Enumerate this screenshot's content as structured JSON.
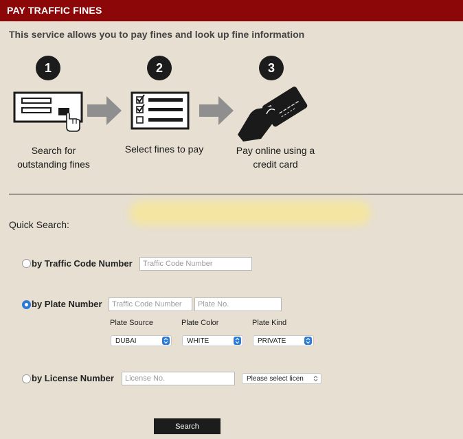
{
  "header": {
    "title": "PAY TRAFFIC FINES"
  },
  "intro": "This service allows you to pay fines and look up fine information",
  "steps": [
    {
      "number": "1",
      "line1": "Search for",
      "line2": "outstanding fines",
      "icon": "search-form-icon"
    },
    {
      "number": "2",
      "line1": "Select fines to pay",
      "line2": "",
      "icon": "checklist-icon"
    },
    {
      "number": "3",
      "line1": "Pay online using a",
      "line2": "credit card",
      "icon": "credit-card-hand-icon"
    }
  ],
  "quick_search": {
    "title": "Quick Search:",
    "traffic_code": {
      "label": "by Traffic Code Number",
      "selected": false,
      "placeholder": "Traffic Code Number",
      "value": ""
    },
    "plate": {
      "label": "by Plate Number",
      "selected": true,
      "code_placeholder": "Traffic Code Number",
      "plate_placeholder": "Plate No.",
      "source_label": "Plate Source",
      "color_label": "Plate Color",
      "kind_label": "Plate Kind",
      "source_value": "DUBAI",
      "color_value": "WHITE",
      "kind_value": "PRIVATE"
    },
    "license": {
      "label": "by License Number",
      "selected": false,
      "placeholder": "License No.",
      "select_value": "Please select licen"
    },
    "search_label": "Search"
  },
  "colors": {
    "header_bg": "#8c0808",
    "page_bg": "#e6dfd2",
    "accent_blue": "#2b7bd6",
    "button_bg": "#1c1c1c",
    "arrow_gray": "#8f8f8f"
  }
}
